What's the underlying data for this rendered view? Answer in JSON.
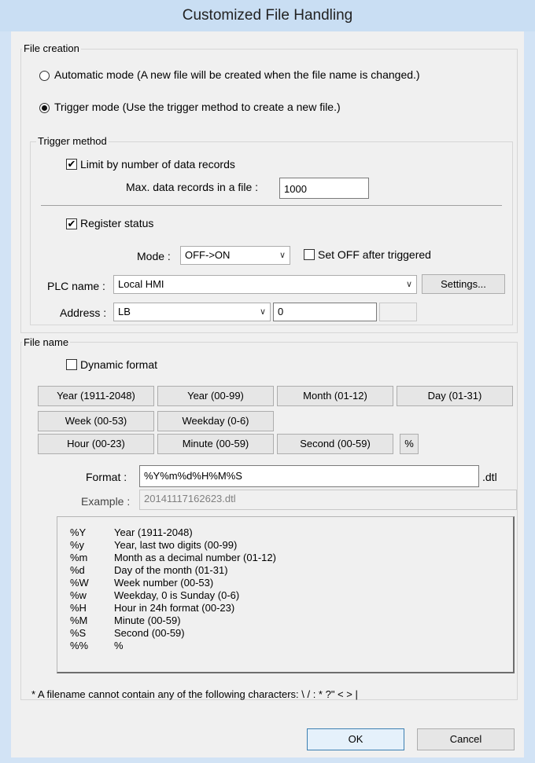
{
  "window": {
    "title": "Customized File Handling"
  },
  "file_creation": {
    "label": "File creation",
    "automatic_mode": "Automatic mode (A new file will be created when the file name is changed.)",
    "trigger_mode": "Trigger mode (Use the trigger method to create a new file.)",
    "selected": "trigger"
  },
  "trigger_method": {
    "label": "Trigger method",
    "limit_checkbox": "Limit by number of data records",
    "limit_checked": true,
    "max_records_label": "Max. data records in a file :",
    "max_records_value": "1000",
    "register_checkbox": "Register status",
    "register_checked": true,
    "mode_label": "Mode :",
    "mode_value": "OFF->ON",
    "set_off_label": "Set OFF after triggered",
    "set_off_checked": false,
    "plc_label": "PLC name :",
    "plc_value": "Local HMI",
    "settings_button": "Settings...",
    "address_label": "Address :",
    "address_type": "LB",
    "address_value": "0"
  },
  "file_name": {
    "label": "File name",
    "dynamic_format": "Dynamic format",
    "dynamic_checked": false,
    "buttons": {
      "year_full": "Year (1911-2048)",
      "year_short": "Year (00-99)",
      "month": "Month (01-12)",
      "day": "Day (01-31)",
      "week": "Week (00-53)",
      "weekday": "Weekday (0-6)",
      "hour": "Hour (00-23)",
      "minute": "Minute (00-59)",
      "second": "Second (00-59)",
      "percent": "%"
    },
    "format_label": "Format :",
    "format_value": "%Y%m%d%H%M%S",
    "format_ext": ".dtl",
    "example_label": "Example :",
    "example_value": "20141117162623.dtl",
    "help": [
      {
        "code": "%Y",
        "desc": "Year (1911-2048)"
      },
      {
        "code": "%y",
        "desc": "Year, last two digits (00-99)"
      },
      {
        "code": "%m",
        "desc": "Month as a decimal number (01-12)"
      },
      {
        "code": "%d",
        "desc": "Day of the month (01-31)"
      },
      {
        "code": "%W",
        "desc": "Week number (00-53)"
      },
      {
        "code": "%w",
        "desc": "Weekday, 0 is Sunday (0-6)"
      },
      {
        "code": "%H",
        "desc": "Hour in 24h format (00-23)"
      },
      {
        "code": "%M",
        "desc": "Minute (00-59)"
      },
      {
        "code": "%S",
        "desc": "Second (00-59)"
      },
      {
        "code": "%%",
        "desc": "%"
      }
    ],
    "note": "* A filename cannot contain any of the following characters:  \\ / : * ?\" < > |"
  },
  "footer": {
    "ok": "OK",
    "cancel": "Cancel"
  }
}
